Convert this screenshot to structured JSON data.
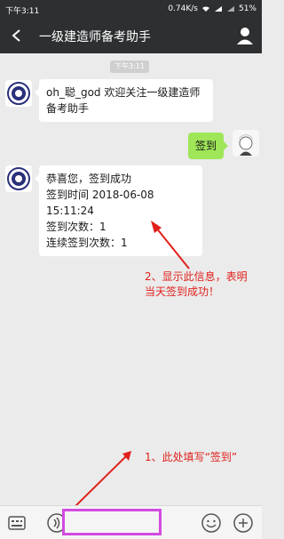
{
  "status_bar": {
    "time": "下午3:11",
    "network_speed": "0.74K/s",
    "battery": "51%"
  },
  "title_bar": {
    "title": "一级建造师备考助手"
  },
  "chat": {
    "timestamp": "下午3:11",
    "messages": [
      {
        "from": "bot",
        "text": "oh_聪_god 欢迎关注一级建造师备考助手"
      },
      {
        "from": "user",
        "text": "签到"
      },
      {
        "from": "bot",
        "lines": [
          "恭喜您，签到成功",
          "签到时间 2018-06-08 15:11:24",
          "签到次数：1",
          "连续签到次数：1"
        ]
      }
    ]
  },
  "annotations": {
    "note_2": [
      "2、显示此信息，表明",
      "当天签到成功！"
    ],
    "note_1": "1、此处填写“签到”"
  },
  "colors": {
    "header_bg": "#2d2f30",
    "chat_bg": "#ebebeb",
    "user_bubble": "#9fe658",
    "annotation_red": "#e0201b",
    "input_highlight": "#d24be0"
  },
  "icons": {
    "back": "back-arrow-icon",
    "profile": "profile-icon",
    "keyboard": "keyboard-menu-icon",
    "voice": "voice-icon",
    "emoji": "emoji-icon",
    "plus": "plus-icon"
  }
}
